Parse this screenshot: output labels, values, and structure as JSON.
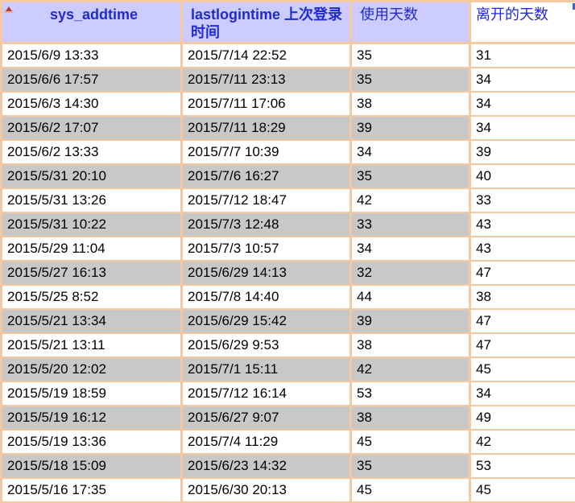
{
  "columns": [
    {
      "label": "sys_addtime",
      "bold": true
    },
    {
      "label": "lastlogintime 上次登录时间",
      "bold": true
    },
    {
      "label": "使用天数",
      "bold": false
    },
    {
      "label": "离开的天数",
      "bold": false
    }
  ],
  "rows": [
    [
      "2015/6/9 13:33",
      "2015/7/14 22:52",
      "35",
      "31"
    ],
    [
      "2015/6/6 17:57",
      "2015/7/11 23:13",
      "35",
      "34"
    ],
    [
      "2015/6/3 14:30",
      "2015/7/11 17:06",
      "38",
      "34"
    ],
    [
      "2015/6/2 17:07",
      "2015/7/11 18:29",
      "39",
      "34"
    ],
    [
      "2015/6/2 13:33",
      "2015/7/7 10:39",
      "34",
      "39"
    ],
    [
      "2015/5/31 20:10",
      "2015/7/6 16:27",
      "35",
      "40"
    ],
    [
      "2015/5/31 13:26",
      "2015/7/12 18:47",
      "42",
      "33"
    ],
    [
      "2015/5/31 10:22",
      "2015/7/3 12:48",
      "33",
      "43"
    ],
    [
      "2015/5/29 11:04",
      "2015/7/3 10:57",
      "34",
      "43"
    ],
    [
      "2015/5/27 16:13",
      "2015/6/29 14:13",
      "32",
      "47"
    ],
    [
      "2015/5/25 8:52",
      "2015/7/8 14:40",
      "44",
      "38"
    ],
    [
      "2015/5/21 13:34",
      "2015/6/29 15:42",
      "39",
      "47"
    ],
    [
      "2015/5/21 13:11",
      "2015/6/29 9:53",
      "38",
      "47"
    ],
    [
      "2015/5/20 12:02",
      "2015/7/1 15:11",
      "42",
      "45"
    ],
    [
      "2015/5/19 18:59",
      "2015/7/12 16:14",
      "53",
      "34"
    ],
    [
      "2015/5/19 16:12",
      "2015/6/27 9:07",
      "38",
      "49"
    ],
    [
      "2015/5/19 13:36",
      "2015/7/4 11:29",
      "45",
      "42"
    ],
    [
      "2015/5/18 15:09",
      "2015/6/23 14:32",
      "35",
      "53"
    ],
    [
      "2015/5/16 17:35",
      "2015/6/30 20:13",
      "45",
      "45"
    ]
  ],
  "colors": {
    "header_bg": "#ccccff",
    "header_text": "#1f2bd0",
    "border": "#f5c9a0",
    "alt_row": "#c8c8c8"
  },
  "icons": [
    "sort-indicator-icon"
  ]
}
